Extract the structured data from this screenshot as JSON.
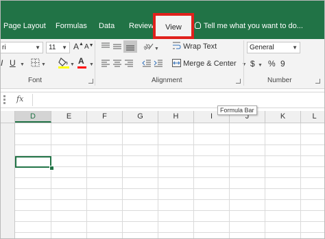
{
  "tabs": [
    {
      "id": "page-layout",
      "label": "Page Layout"
    },
    {
      "id": "formulas",
      "label": "Formulas"
    },
    {
      "id": "data",
      "label": "Data"
    },
    {
      "id": "review",
      "label": "Review"
    }
  ],
  "active_tab": {
    "label": "View"
  },
  "tell_me": {
    "text": "Tell me what you want to do..."
  },
  "font_group": {
    "font_name": "ri",
    "font_size": "11",
    "label": "Font",
    "grow_icon": "A",
    "shrink_icon": "A",
    "underline_icon": "U",
    "font_color_icon": "A",
    "font_color": "#ff0000",
    "fill_color": "#ffff00"
  },
  "alignment_group": {
    "wrap_text": "Wrap Text",
    "merge_center": "Merge & Center",
    "label": "Alignment"
  },
  "number_group": {
    "format": "General",
    "currency_symbol": "$",
    "percent_symbol": "%",
    "comma_symbol": "9",
    "label": "Number"
  },
  "formula_bar": {
    "fx_label": "fx",
    "value": ""
  },
  "tooltip": {
    "text": "Formula Bar"
  },
  "columns": [
    "D",
    "E",
    "F",
    "G",
    "H",
    "I",
    "J",
    "K",
    "L"
  ],
  "active_column": "D",
  "colors": {
    "brand": "#217346",
    "highlight": "#e0211c",
    "ribbon": "#f3f3f3"
  }
}
